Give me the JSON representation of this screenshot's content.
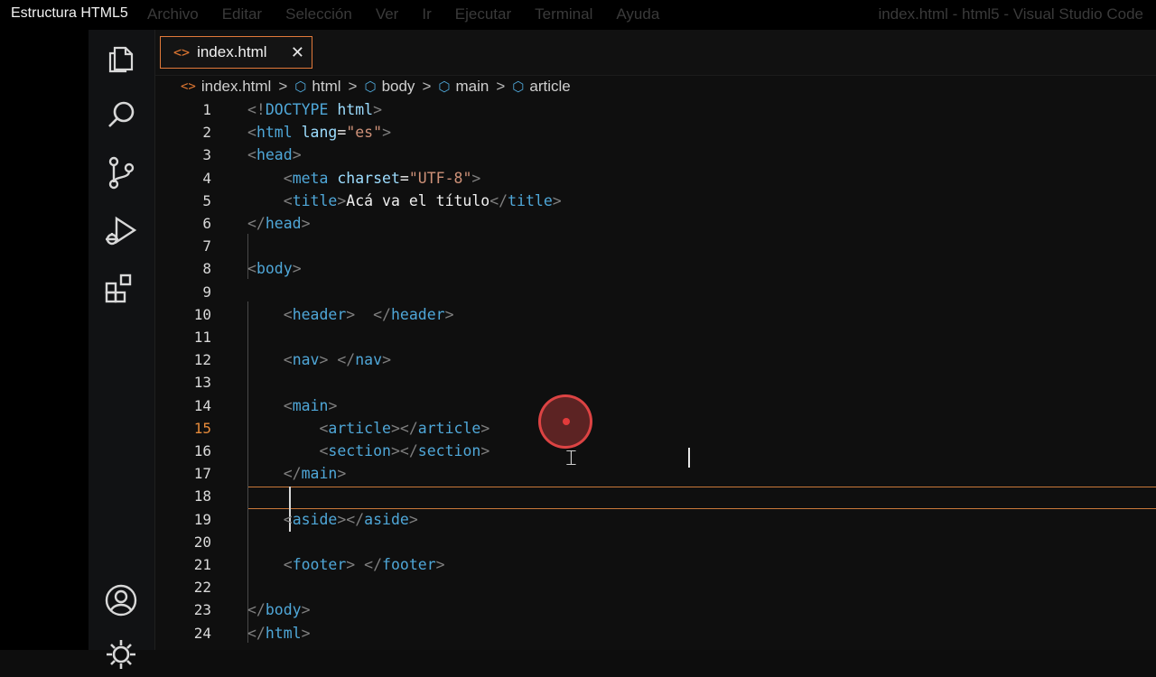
{
  "titlebar": {
    "app_caption": "Estructura HTML5",
    "menu": [
      "Archivo",
      "Editar",
      "Selección",
      "Ver",
      "Ir",
      "Ejecutar",
      "Terminal",
      "Ayuda"
    ],
    "window_title": "index.html - html5 - Visual Studio Code"
  },
  "activity_bar": {
    "icons": [
      "files-icon",
      "search-icon",
      "source-control-icon",
      "run-debug-icon",
      "extensions-icon",
      "account-icon",
      "settings-gear-icon"
    ]
  },
  "tab": {
    "icon": "<>",
    "label": "index.html",
    "close": "✕"
  },
  "breadcrumb": {
    "file_icon": "<>",
    "file": "index.html",
    "separator": ">",
    "cube_icon": "⬡",
    "items": [
      "html",
      "body",
      "main",
      "article"
    ]
  },
  "editor": {
    "active_line": 15,
    "lines": [
      {
        "num": "1",
        "text": "<!DOCTYPE html>"
      },
      {
        "num": "2",
        "text": "<html lang=\"es\">"
      },
      {
        "num": "3",
        "text": "<head>"
      },
      {
        "num": "4",
        "text": "    <meta charset=\"UTF-8\">"
      },
      {
        "num": "5",
        "text": "    <title>Acá va el título</title>"
      },
      {
        "num": "6",
        "text": "</head>"
      },
      {
        "num": "7",
        "text": ""
      },
      {
        "num": "8",
        "text": "<body>"
      },
      {
        "num": "9",
        "text": ""
      },
      {
        "num": "10",
        "text": "    <header>  </header>"
      },
      {
        "num": "11",
        "text": ""
      },
      {
        "num": "12",
        "text": "    <nav> </nav>"
      },
      {
        "num": "13",
        "text": ""
      },
      {
        "num": "14",
        "text": "    <main>"
      },
      {
        "num": "15",
        "text": "        <article></article>"
      },
      {
        "num": "16",
        "text": "        <section></section>"
      },
      {
        "num": "17",
        "text": "    </main>"
      },
      {
        "num": "18",
        "text": ""
      },
      {
        "num": "19",
        "text": "    <aside></aside>"
      },
      {
        "num": "20",
        "text": ""
      },
      {
        "num": "21",
        "text": "    <footer> </footer>"
      },
      {
        "num": "22",
        "text": ""
      },
      {
        "num": "23",
        "text": "</body>"
      },
      {
        "num": "24",
        "text": "</html>"
      }
    ]
  },
  "colors": {
    "tag": "#4fa7d8",
    "punctuation": "#7f7f7f",
    "attribute": "#9cdcfe",
    "string": "#ce9178",
    "accent": "#e2793a",
    "click_marker": "#e23b3b"
  }
}
